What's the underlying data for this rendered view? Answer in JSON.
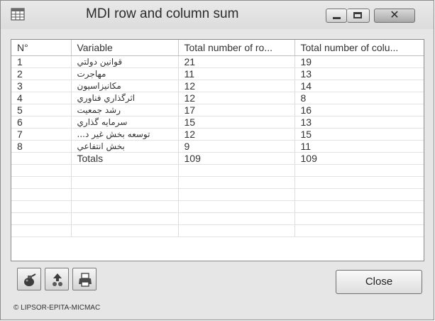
{
  "window": {
    "title": "MDI row and column sum",
    "close_glyph": "✕"
  },
  "table": {
    "columns": [
      "N°",
      "Variable",
      "Total number of ro...",
      "Total number of colu..."
    ],
    "rows": [
      [
        "1",
        "قوانين دولتي",
        "21",
        "19"
      ],
      [
        "2",
        "مهاجرت",
        "11",
        "13"
      ],
      [
        "3",
        "مكانيزاسيون",
        "12",
        "14"
      ],
      [
        "4",
        "اثرگذاري فناوري",
        "12",
        "8"
      ],
      [
        "5",
        "رشد جمعيت",
        "17",
        "16"
      ],
      [
        "6",
        "سرمايه گذاري",
        "15",
        "13"
      ],
      [
        "7",
        "توسعه بخش غير د...",
        "12",
        "15"
      ],
      [
        "8",
        "بخش انتفاعي",
        "9",
        "11"
      ],
      [
        "",
        "Totals",
        "109",
        "109"
      ]
    ],
    "empty_row_count": 6
  },
  "toolbar": {
    "buttons": [
      {
        "icon": "grenade-icon"
      },
      {
        "icon": "export-arrow-icon"
      },
      {
        "icon": "printer-icon"
      }
    ]
  },
  "footer": {
    "close_label": "Close",
    "copyright": "© LIPSOR-EPITA-MICMAC"
  },
  "colors": {
    "window_bg": "#e6e6e6",
    "titlebar": "#dedede",
    "grid_bg": "#ffffff"
  }
}
